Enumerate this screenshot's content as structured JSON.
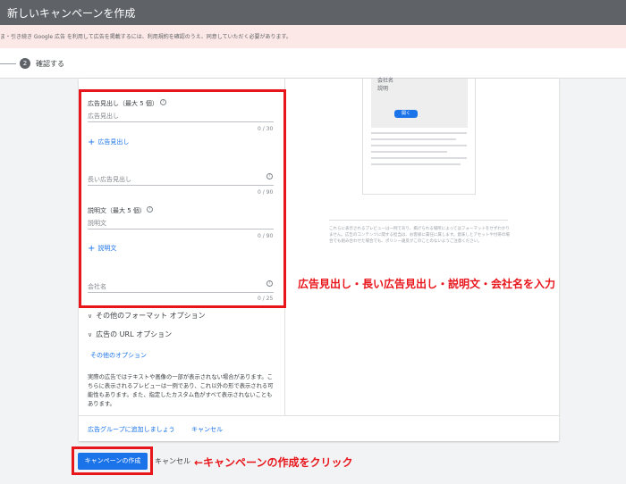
{
  "header": {
    "title": "新しいキャンペーンを作成"
  },
  "banner": {
    "text": "ま・引き続き Google 広告 を利用して広告を掲載するには、利用規約を確認のうえ、同意していただく必要があります。"
  },
  "stepper": {
    "step_number": "2",
    "step_label": "確認する"
  },
  "form": {
    "headline": {
      "title": "広告見出し（最大 5 個）",
      "placeholder": "広告見出し",
      "counter": "0 / 30",
      "add_label": "広告見出し"
    },
    "long_headline": {
      "placeholder": "長い広告見出し",
      "counter": "0 / 90"
    },
    "description": {
      "title": "説明文（最大 5 個）",
      "placeholder": "説明文",
      "counter": "0 / 90",
      "add_label": "説明文"
    },
    "business_name": {
      "placeholder": "会社名",
      "counter": "0 / 25"
    },
    "help_glyph": "?",
    "plus_glyph": "+",
    "options": {
      "format_options": "その他のフォーマット オプション",
      "url_options": "広告の URL オプション",
      "other_options_link": "その他のオプション",
      "chevron": "∨"
    },
    "notice": "実際の広告ではテキストや画像の一部が表示されない場合があります。こちらに表示されるプレビューは一例であり、これ以外の形で表示される可能性もあります。また、指定したカスタム色がすべて表示されないこともあります。"
  },
  "card_footer": {
    "add_to_group": "広告グループに追加しましょう",
    "cancel": "キャンセル"
  },
  "preview": {
    "line1": "会社名",
    "line2": "説明",
    "button": "開く"
  },
  "disclaimer": "これらに表示されるプレビューは一例であり、掲げられる場所によってはフォーマットをせずわかりません。広告のコンテンツに関する担当は、お客様に責任に属します。意味しとアセットや付帯の場合でも組み合わせた場合でも、ポリシー違反がこのことのないようご注意ください。",
  "annotations": {
    "fields_note": "広告見出し・長い広告見出し・説明文・会社名を入力",
    "create_note": "←キャンペーンの作成をクリック"
  },
  "actions": {
    "create": "キャンペーンの作成",
    "cancel": "キャンセル"
  },
  "colors": {
    "accent": "#1a73e8",
    "annotation_red": "#e8151b",
    "topbar": "#5f6368"
  }
}
